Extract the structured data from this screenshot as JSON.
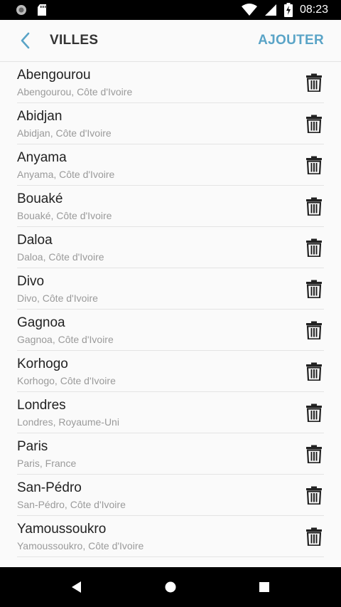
{
  "status_bar": {
    "time": "08:23"
  },
  "app_bar": {
    "title": "VILLES",
    "action_label": "AJOUTER"
  },
  "cities": [
    {
      "name": "Abengourou",
      "location": "Abengourou, Côte d'Ivoire"
    },
    {
      "name": "Abidjan",
      "location": "Abidjan, Côte d'Ivoire"
    },
    {
      "name": "Anyama",
      "location": "Anyama, Côte d'Ivoire"
    },
    {
      "name": "Bouaké",
      "location": "Bouaké, Côte d'Ivoire"
    },
    {
      "name": "Daloa",
      "location": "Daloa, Côte d'Ivoire"
    },
    {
      "name": "Divo",
      "location": "Divo, Côte d'Ivoire"
    },
    {
      "name": "Gagnoa",
      "location": "Gagnoa, Côte d'Ivoire"
    },
    {
      "name": "Korhogo",
      "location": "Korhogo, Côte d'Ivoire"
    },
    {
      "name": "Londres",
      "location": "Londres, Royaume-Uni"
    },
    {
      "name": "Paris",
      "location": "Paris, France"
    },
    {
      "name": "San-Pédro",
      "location": "San-Pédro, Côte d'Ivoire"
    },
    {
      "name": "Yamoussoukro",
      "location": "Yamoussoukro, Côte d'Ivoire"
    }
  ],
  "colors": {
    "accent": "#5aa4c7",
    "text": "#222222",
    "subtext": "#9a9a9a"
  }
}
